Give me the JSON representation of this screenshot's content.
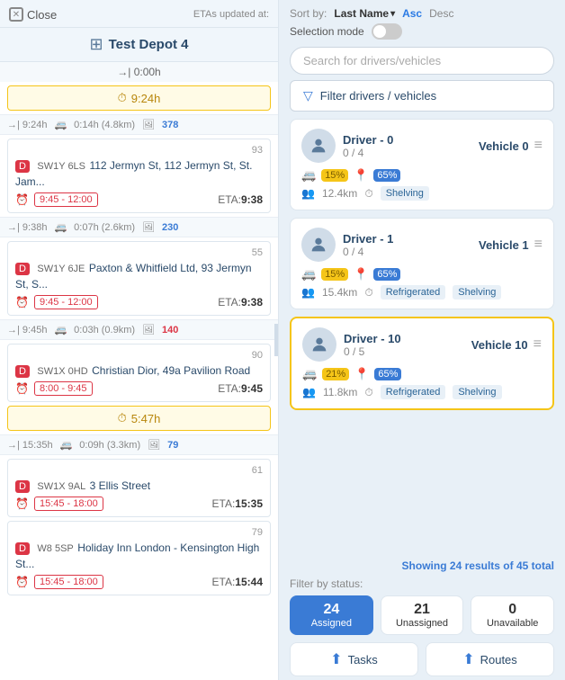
{
  "header": {
    "close_label": "Close",
    "eta_label": "ETAs updated at:",
    "expand_icon": "›"
  },
  "depot": {
    "name": "Test Depot 4",
    "duration": "→| 0:00h"
  },
  "route": {
    "total_time": "9:24h",
    "separators": [
      {
        "time": "→| 9:24h",
        "drive": "0:14h (4.8km)",
        "stops": "378"
      },
      {
        "time": "→| 9:38h",
        "drive": "0:07h (2.6km)",
        "stops": "230"
      },
      {
        "time": "→| 9:45h",
        "drive": "0:03h (0.9km)",
        "stops": "140"
      },
      {
        "time": "→| 15:35h",
        "drive": "0:09h (3.3km)",
        "stops": "79"
      }
    ],
    "yellow_bars": [
      {
        "time": "9:24h"
      },
      {
        "time": "5:47h"
      }
    ],
    "stops": [
      {
        "num": 93,
        "label": "D",
        "postcode": "SW1Y 6LS",
        "address": "112 Jermyn St, 112 Jermyn St, St. Jam...",
        "window": "9:45 - 12:00",
        "eta_label": "ETA:",
        "eta": "9:38"
      },
      {
        "num": 55,
        "label": "D",
        "postcode": "SW1Y 6JE",
        "address": "Paxton & Whitfield Ltd, 93 Jermyn St, S...",
        "window": "9:45 - 12:00",
        "eta_label": "ETA:",
        "eta": "9:38"
      },
      {
        "num": 90,
        "label": "D",
        "postcode": "SW1X 0HD",
        "address": "Christian Dior, 49a Pavilion Road",
        "window": "8:00 - 9:45",
        "eta_label": "ETA:",
        "eta": "9:45"
      },
      {
        "num": 61,
        "label": "D",
        "postcode": "SW1X 9AL",
        "address": "3 Ellis Street",
        "window": "15:45 - 18:00",
        "eta_label": "ETA:",
        "eta": "15:35"
      },
      {
        "num": 79,
        "label": "D",
        "postcode": "W8 5SP",
        "address": "Holiday Inn London - Kensington High St...",
        "window": "15:45 - 18:00",
        "eta_label": "ETA:",
        "eta": "15:44"
      }
    ]
  },
  "right": {
    "sort_label": "Sort by:",
    "sort_field": "Last Name",
    "sort_asc": "Asc",
    "sort_desc": "Desc",
    "selection_mode_label": "Selection mode",
    "search_placeholder": "Search for drivers/vehicles",
    "filter_label": "Filter drivers / vehicles",
    "showing_text": "Showing",
    "showing_count": "24",
    "showing_of": "results of",
    "showing_total": "45",
    "showing_total_label": "total",
    "filter_status_label": "Filter by status:",
    "drivers": [
      {
        "name": "Driver - 0",
        "slots": "0 / 4",
        "vehicle": "Vehicle 0",
        "pct_yellow": "15%",
        "pct_blue": "65%",
        "distance": "12.4km",
        "tags": [
          "Shelving"
        ],
        "highlighted": false
      },
      {
        "name": "Driver - 1",
        "slots": "0 / 4",
        "vehicle": "Vehicle 1",
        "pct_yellow": "15%",
        "pct_blue": "65%",
        "distance": "15.4km",
        "tags": [
          "Refrigerated",
          "Shelving"
        ],
        "highlighted": false
      },
      {
        "name": "Driver - 10",
        "slots": "0 / 5",
        "vehicle": "Vehicle 10",
        "pct_yellow": "21%",
        "pct_blue": "65%",
        "distance": "11.8km",
        "tags": [
          "Refrigerated",
          "Shelving"
        ],
        "highlighted": true
      }
    ],
    "status_tabs": [
      {
        "count": "24",
        "label": "Assigned",
        "active": true
      },
      {
        "count": "21",
        "label": "Unassigned",
        "active": false
      },
      {
        "count": "0",
        "label": "Unavailable",
        "active": false
      }
    ],
    "actions": [
      {
        "label": "Tasks"
      },
      {
        "label": "Routes"
      }
    ]
  }
}
